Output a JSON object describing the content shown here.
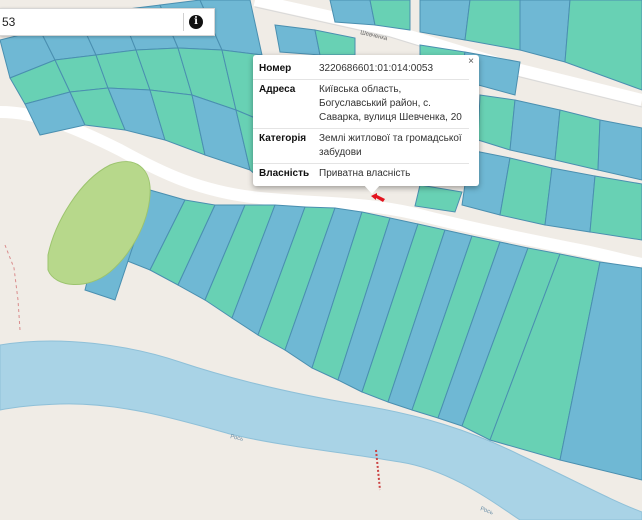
{
  "search": {
    "value": "53",
    "info_icon": "info-icon"
  },
  "popup": {
    "close_label": "×",
    "rows": [
      {
        "key": "Номер",
        "value": "3220686601:01:014:0053"
      },
      {
        "key": "Адреса",
        "value": "Київська область, Богуславський район, с. Саварка, вулиця Шевченка, 20"
      },
      {
        "key": "Категорія",
        "value": "Землі житлової та громадської забудови"
      },
      {
        "key": "Власність",
        "value": "Приватна власність"
      }
    ]
  },
  "map": {
    "street_label": "Шевченка",
    "river_label_1": "Рось",
    "river_label_2": "Рось",
    "marker_icon": "parcel-arrow-icon",
    "colors": {
      "background": "#f0ece6",
      "road": "#ffffff",
      "river": "#a9d3e6",
      "parcel_blue": "#6fb8d4",
      "parcel_green": "#68d1b4",
      "parcel_border": "#4a8fb0",
      "forest": "#b7d88b",
      "marker": "#e3141f"
    }
  }
}
